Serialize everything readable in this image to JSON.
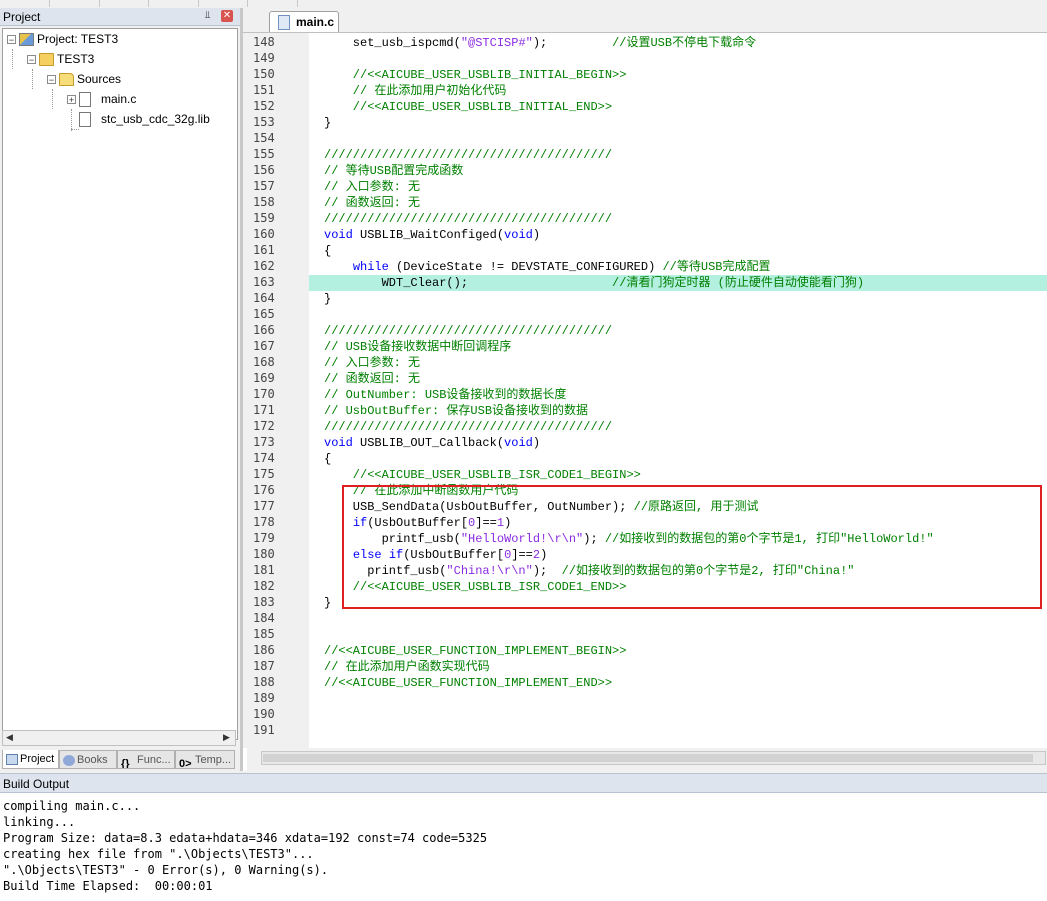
{
  "project_panel": {
    "title": "Project",
    "pin_icon": "pin-icon",
    "tree": {
      "project": "Project: TEST3",
      "target": "TEST3",
      "group": "Sources",
      "files": [
        "main.c",
        "stc_usb_cdc_32g.lib"
      ]
    },
    "tabs": [
      "Project",
      "Books",
      "Func...",
      "Temp..."
    ]
  },
  "editor": {
    "tab": "main.c",
    "highlight_line": 163,
    "lines": [
      {
        "n": "148",
        "segs": [
          {
            "t": "    set_usb_ispcmd(",
            "c": "black"
          },
          {
            "t": "\"@STCISP#\"",
            "c": "purple"
          },
          {
            "t": ");         ",
            "c": "black"
          },
          {
            "t": "//设置USB不停电下载命令",
            "c": "green"
          }
        ]
      },
      {
        "n": "149",
        "segs": []
      },
      {
        "n": "150",
        "segs": [
          {
            "t": "    //<<AICUBE_USER_USBLIB_INITIAL_BEGIN>>",
            "c": "green"
          }
        ]
      },
      {
        "n": "151",
        "segs": [
          {
            "t": "    // 在此添加用户初始化代码",
            "c": "green"
          }
        ]
      },
      {
        "n": "152",
        "segs": [
          {
            "t": "    //<<AICUBE_USER_USBLIB_INITIAL_END>>",
            "c": "green"
          }
        ]
      },
      {
        "n": "153",
        "segs": [
          {
            "t": "}",
            "c": "black"
          }
        ]
      },
      {
        "n": "154",
        "segs": []
      },
      {
        "n": "155",
        "segs": [
          {
            "t": "////////////////////////////////////////",
            "c": "green"
          }
        ]
      },
      {
        "n": "156",
        "segs": [
          {
            "t": "// 等待USB配置完成函数",
            "c": "green"
          }
        ]
      },
      {
        "n": "157",
        "segs": [
          {
            "t": "// 入口参数: 无",
            "c": "green"
          }
        ]
      },
      {
        "n": "158",
        "segs": [
          {
            "t": "// 函数返回: 无",
            "c": "green"
          }
        ]
      },
      {
        "n": "159",
        "segs": [
          {
            "t": "////////////////////////////////////////",
            "c": "green"
          }
        ]
      },
      {
        "n": "160",
        "segs": [
          {
            "t": "void",
            "c": "blue"
          },
          {
            "t": " USBLIB_WaitConfiged(",
            "c": "black"
          },
          {
            "t": "void",
            "c": "blue"
          },
          {
            "t": ")",
            "c": "black"
          }
        ]
      },
      {
        "n": "161",
        "segs": [
          {
            "t": "{",
            "c": "black"
          }
        ]
      },
      {
        "n": "162",
        "segs": [
          {
            "t": "    ",
            "c": "black"
          },
          {
            "t": "while",
            "c": "blue"
          },
          {
            "t": " (DeviceState != DEVSTATE_CONFIGURED) ",
            "c": "black"
          },
          {
            "t": "//等待USB完成配置",
            "c": "green"
          }
        ]
      },
      {
        "n": "163",
        "segs": [
          {
            "t": "        WDT_Clear();                    ",
            "c": "black"
          },
          {
            "t": "//清看门狗定时器 (防止硬件自动使能看门狗)",
            "c": "green"
          }
        ]
      },
      {
        "n": "164",
        "segs": [
          {
            "t": "}",
            "c": "black"
          }
        ]
      },
      {
        "n": "165",
        "segs": []
      },
      {
        "n": "166",
        "segs": [
          {
            "t": "////////////////////////////////////////",
            "c": "green"
          }
        ]
      },
      {
        "n": "167",
        "segs": [
          {
            "t": "// USB设备接收数据中断回调程序",
            "c": "green"
          }
        ]
      },
      {
        "n": "168",
        "segs": [
          {
            "t": "// 入口参数: 无",
            "c": "green"
          }
        ]
      },
      {
        "n": "169",
        "segs": [
          {
            "t": "// 函数返回: 无",
            "c": "green"
          }
        ]
      },
      {
        "n": "170",
        "segs": [
          {
            "t": "// OutNumber: USB设备接收到的数据长度",
            "c": "green"
          }
        ]
      },
      {
        "n": "171",
        "segs": [
          {
            "t": "// UsbOutBuffer: 保存USB设备接收到的数据",
            "c": "green"
          }
        ]
      },
      {
        "n": "172",
        "segs": [
          {
            "t": "////////////////////////////////////////",
            "c": "green"
          }
        ]
      },
      {
        "n": "173",
        "segs": [
          {
            "t": "void",
            "c": "blue"
          },
          {
            "t": " USBLIB_OUT_Callback(",
            "c": "black"
          },
          {
            "t": "void",
            "c": "blue"
          },
          {
            "t": ")",
            "c": "black"
          }
        ]
      },
      {
        "n": "174",
        "segs": [
          {
            "t": "{",
            "c": "black"
          }
        ]
      },
      {
        "n": "175",
        "segs": [
          {
            "t": "    //<<AICUBE_USER_USBLIB_ISR_CODE1_BEGIN>>",
            "c": "green"
          }
        ]
      },
      {
        "n": "176",
        "segs": [
          {
            "t": "    // 在此添加中断函数用户代码",
            "c": "green"
          }
        ]
      },
      {
        "n": "177",
        "segs": [
          {
            "t": "    USB_SendData(UsbOutBuffer, OutNumber); ",
            "c": "black"
          },
          {
            "t": "//原路返回, 用于测试",
            "c": "green"
          }
        ]
      },
      {
        "n": "178",
        "segs": [
          {
            "t": "    ",
            "c": "black"
          },
          {
            "t": "if",
            "c": "blue"
          },
          {
            "t": "(UsbOutBuffer[",
            "c": "black"
          },
          {
            "t": "0",
            "c": "purple"
          },
          {
            "t": "]==",
            "c": "black"
          },
          {
            "t": "1",
            "c": "purple"
          },
          {
            "t": ")",
            "c": "black"
          }
        ]
      },
      {
        "n": "179",
        "segs": [
          {
            "t": "        printf_usb(",
            "c": "black"
          },
          {
            "t": "\"HelloWorld!\\r\\n\"",
            "c": "purple"
          },
          {
            "t": "); ",
            "c": "black"
          },
          {
            "t": "//如接收到的数据包的第0个字节是1, 打印\"HelloWorld!\"",
            "c": "green"
          }
        ]
      },
      {
        "n": "180",
        "segs": [
          {
            "t": "    ",
            "c": "black"
          },
          {
            "t": "else if",
            "c": "blue"
          },
          {
            "t": "(UsbOutBuffer[",
            "c": "black"
          },
          {
            "t": "0",
            "c": "purple"
          },
          {
            "t": "]==",
            "c": "black"
          },
          {
            "t": "2",
            "c": "purple"
          },
          {
            "t": ")",
            "c": "black"
          }
        ]
      },
      {
        "n": "181",
        "segs": [
          {
            "t": "      printf_usb(",
            "c": "black"
          },
          {
            "t": "\"China!\\r\\n\"",
            "c": "purple"
          },
          {
            "t": ");  ",
            "c": "black"
          },
          {
            "t": "//如接收到的数据包的第0个字节是2, 打印\"China!\"",
            "c": "green"
          }
        ]
      },
      {
        "n": "182",
        "segs": [
          {
            "t": "    //<<AICUBE_USER_USBLIB_ISR_CODE1_END>>",
            "c": "green"
          }
        ]
      },
      {
        "n": "183",
        "segs": [
          {
            "t": "}",
            "c": "black"
          }
        ]
      },
      {
        "n": "184",
        "segs": []
      },
      {
        "n": "185",
        "segs": []
      },
      {
        "n": "186",
        "segs": [
          {
            "t": "//<<AICUBE_USER_FUNCTION_IMPLEMENT_BEGIN>>",
            "c": "green"
          }
        ]
      },
      {
        "n": "187",
        "segs": [
          {
            "t": "// 在此添加用户函数实现代码",
            "c": "green"
          }
        ]
      },
      {
        "n": "188",
        "segs": [
          {
            "t": "//<<AICUBE_USER_FUNCTION_IMPLEMENT_END>>",
            "c": "green"
          }
        ]
      },
      {
        "n": "189",
        "segs": []
      },
      {
        "n": "190",
        "segs": []
      },
      {
        "n": "191",
        "segs": []
      }
    ],
    "colors": {
      "green": "#008000",
      "blue": "#0000ff",
      "purple": "#8a2be2",
      "black": "#000000",
      "highlight": "#b4f0e0",
      "annotation_box": "#e02020"
    }
  },
  "build_output": {
    "title": "Build Output",
    "lines": [
      "compiling main.c...",
      "linking...",
      "Program Size: data=8.3 edata+hdata=346 xdata=192 const=74 code=5325",
      "creating hex file from \".\\Objects\\TEST3\"...",
      "\".\\Objects\\TEST3\" - 0 Error(s), 0 Warning(s).",
      "Build Time Elapsed:  00:00:01"
    ]
  }
}
